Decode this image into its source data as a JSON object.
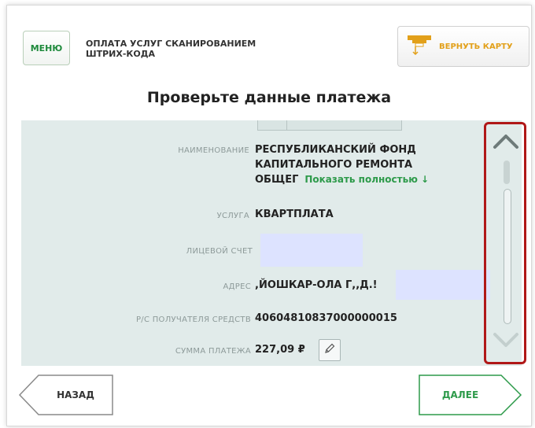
{
  "header": {
    "menu_label": "МЕНЮ",
    "service_title_line1": "ОПЛАТА УСЛУГ СКАНИРОВАНИЕМ",
    "service_title_line2": "ШТРИХ-КОДА",
    "return_card_label": "ВЕРНУТЬ КАРТУ"
  },
  "page_title": "Проверьте данные платежа",
  "fields": {
    "name": {
      "label": "НАИМЕНОВАНИЕ",
      "line1": "РЕСПУБЛИКАНСКИЙ ФОНД",
      "line2": "КАПИТАЛЬНОГО РЕМОНТА",
      "line3": "ОБЩЕГ",
      "show_full": "Показать полностью ↓"
    },
    "service": {
      "label": "УСЛУГА",
      "value": "КВАРТПЛАТА"
    },
    "account": {
      "label": "ЛИЦЕВОЙ СЧЕТ",
      "value": ""
    },
    "address": {
      "label": "АДРЕС",
      "value": ",ЙОШКАР-ОЛА Г,,Д.!"
    },
    "recipient_account": {
      "label": "Р/С ПОЛУЧАТЕЛЯ СРЕДСТВ",
      "value": "40604810837000000015"
    },
    "amount": {
      "label": "СУММА ПЛАТЕЖА",
      "value": "227,09 ₽"
    }
  },
  "footer": {
    "back_label": "НАЗАД",
    "next_label": "ДАЛЕЕ"
  },
  "colors": {
    "accent_green": "#2d9a4a",
    "card_orange": "#e2a01a",
    "panel_bg": "#e1ebea",
    "highlight_red": "#b01818"
  }
}
